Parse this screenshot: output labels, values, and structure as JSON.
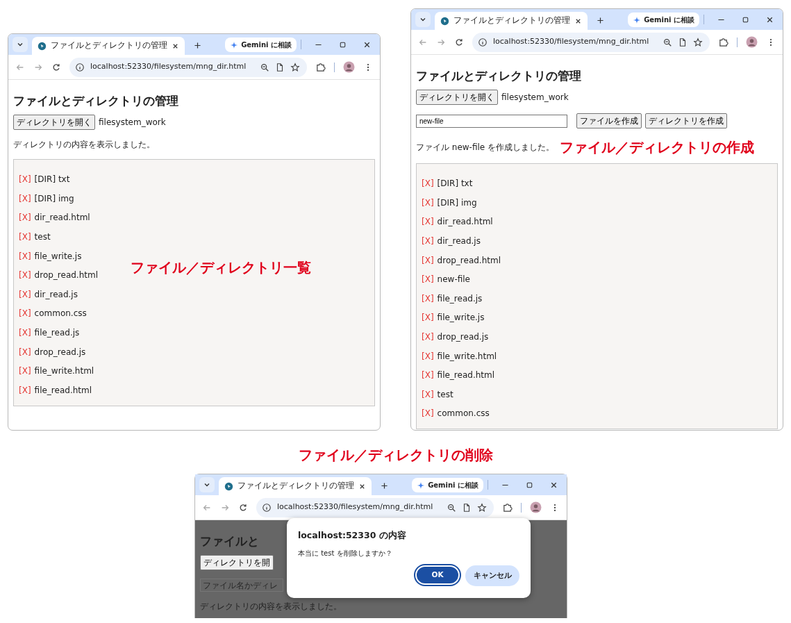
{
  "screens": [
    {
      "kind": "list",
      "tab_title": "ファイルとディレクトリの管理",
      "gemini": "Gemini に相談",
      "url": "localhost:52330/filesystem/mng_dir.html",
      "page": {
        "heading": "ファイルとディレクトリの管理",
        "open_button": "ディレクトリを開く",
        "folder": "filesystem_work",
        "status": "ディレクトリの内容を表示しました。",
        "entries": [
          {
            "mark": "[X]",
            "name": "[DIR] txt"
          },
          {
            "mark": "[X]",
            "name": "[DIR] img"
          },
          {
            "mark": "[X]",
            "name": "dir_read.html"
          },
          {
            "mark": "[X]",
            "name": "test"
          },
          {
            "mark": "[X]",
            "name": "file_write.js"
          },
          {
            "mark": "[X]",
            "name": "drop_read.html"
          },
          {
            "mark": "[X]",
            "name": "dir_read.js"
          },
          {
            "mark": "[X]",
            "name": "common.css"
          },
          {
            "mark": "[X]",
            "name": "file_read.js"
          },
          {
            "mark": "[X]",
            "name": "drop_read.js"
          },
          {
            "mark": "[X]",
            "name": "file_write.html"
          },
          {
            "mark": "[X]",
            "name": "file_read.html"
          }
        ]
      },
      "annotation": "ファイル／ディレクトリ一覧"
    },
    {
      "kind": "create",
      "tab_title": "ファイルとディレクトリの管理",
      "gemini": "Gemini に相談",
      "url": "localhost:52330/filesystem/mng_dir.html",
      "page": {
        "heading": "ファイルとディレクトリの管理",
        "open_button": "ディレクトリを開く",
        "folder": "filesystem_work",
        "name_field": {
          "value": "new-file"
        },
        "create_file_button": "ファイルを作成",
        "create_dir_button": "ディレクトリを作成",
        "status": "ファイル new-file を作成しました。",
        "entries": [
          {
            "mark": "[X]",
            "name": "[DIR] txt"
          },
          {
            "mark": "[X]",
            "name": "[DIR] img"
          },
          {
            "mark": "[X]",
            "name": "dir_read.html"
          },
          {
            "mark": "[X]",
            "name": "dir_read.js"
          },
          {
            "mark": "[X]",
            "name": "drop_read.html"
          },
          {
            "mark": "[X]",
            "name": "new-file"
          },
          {
            "mark": "[X]",
            "name": "file_read.js"
          },
          {
            "mark": "[X]",
            "name": "file_write.js"
          },
          {
            "mark": "[X]",
            "name": "drop_read.js"
          },
          {
            "mark": "[X]",
            "name": "file_write.html"
          },
          {
            "mark": "[X]",
            "name": "file_read.html"
          },
          {
            "mark": "[X]",
            "name": "test"
          },
          {
            "mark": "[X]",
            "name": "common.css"
          }
        ]
      },
      "annotation": "ファイル／ディレクトリの作成"
    },
    {
      "kind": "delete",
      "annotation": "ファイル／ディレクトリの削除",
      "tab_title": "ファイルとディレクトリの管理",
      "gemini": "Gemini に相談",
      "url": "localhost:52330/filesystem/mng_dir.html",
      "page": {
        "heading": "ファイルと",
        "open_button": "ディレクトリを開",
        "name_field": {
          "placeholder": "ファイル名かディレ"
        },
        "status": "ディレクトリの内容を表示しました。"
      },
      "dialog": {
        "title": "localhost:52330 の内容",
        "message": "本当に test を削除しますか？",
        "ok": "OK",
        "cancel": "キャンセル"
      }
    }
  ]
}
